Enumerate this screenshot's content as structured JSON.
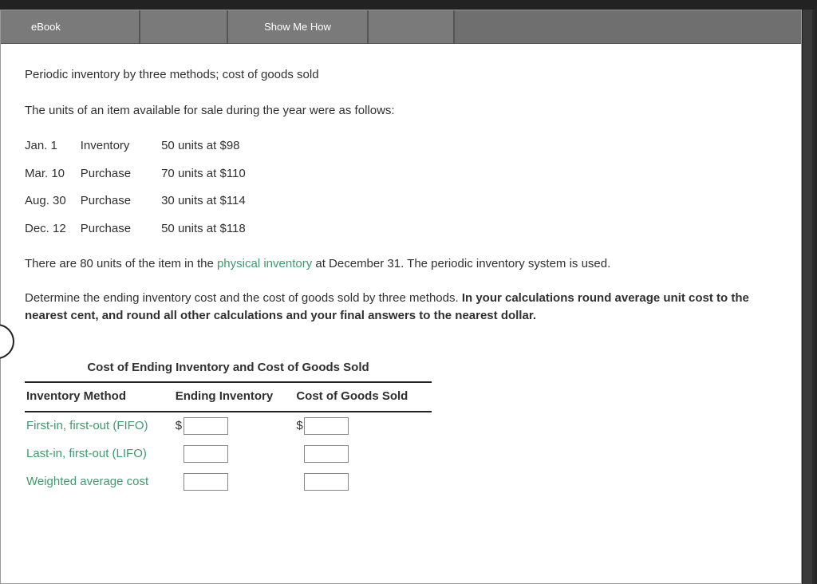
{
  "tabs": {
    "ebook": "eBook",
    "howto": "Show Me How"
  },
  "title": "Periodic inventory by three methods; cost of goods sold",
  "lead": "The units of an item available for sale during the year were as follows:",
  "inventory_rows": [
    {
      "date": "Jan. 1",
      "type": "Inventory",
      "detail": "50 units at $98"
    },
    {
      "date": "Mar. 10",
      "type": "Purchase",
      "detail": "70 units at $110"
    },
    {
      "date": "Aug. 30",
      "type": "Purchase",
      "detail": "30 units at $114"
    },
    {
      "date": "Dec. 12",
      "type": "Purchase",
      "detail": "50 units at $118"
    }
  ],
  "para1_pre": "There are 80 units of the item in the ",
  "para1_term": "physical inventory",
  "para1_post": " at December 31. The periodic inventory system is used.",
  "para2_plain": "Determine the ending inventory cost and the cost of goods sold by three methods. ",
  "para2_bold": "In your calculations round average unit cost to the nearest cent, and round all other calculations and your final answers to the nearest dollar.",
  "answer_title": "Cost of Ending Inventory and Cost of Goods Sold",
  "headers": {
    "c1": "Inventory Method",
    "c2": "Ending Inventory",
    "c3": "Cost of Goods Sold"
  },
  "methods": [
    "First-in, first-out (FIFO)",
    "Last-in, first-out (LIFO)",
    "Weighted average cost"
  ],
  "dollar": "$"
}
